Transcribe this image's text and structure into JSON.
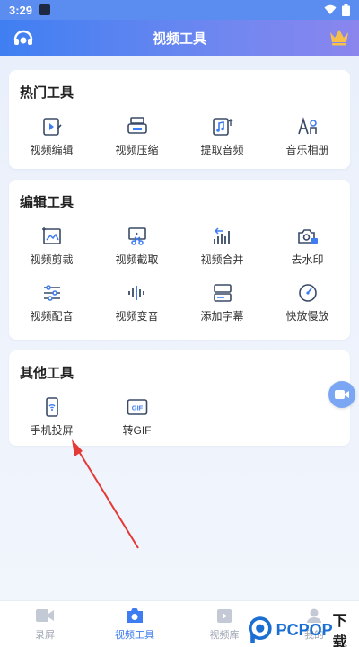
{
  "status": {
    "time": "3:29"
  },
  "header": {
    "title": "视频工具"
  },
  "sections": [
    {
      "title": "热门工具",
      "items": [
        {
          "label": "视频编辑",
          "icon": "video-edit-icon"
        },
        {
          "label": "视频压缩",
          "icon": "video-compress-icon"
        },
        {
          "label": "提取音频",
          "icon": "extract-audio-icon"
        },
        {
          "label": "音乐相册",
          "icon": "music-album-icon"
        }
      ]
    },
    {
      "title": "编辑工具",
      "items": [
        {
          "label": "视频剪裁",
          "icon": "crop-icon"
        },
        {
          "label": "视频截取",
          "icon": "cut-icon"
        },
        {
          "label": "视频合并",
          "icon": "merge-icon"
        },
        {
          "label": "去水印",
          "icon": "watermark-remove-icon"
        },
        {
          "label": "视频配音",
          "icon": "dubbing-icon"
        },
        {
          "label": "视频变音",
          "icon": "voice-change-icon"
        },
        {
          "label": "添加字幕",
          "icon": "subtitle-icon"
        },
        {
          "label": "快放慢放",
          "icon": "speed-icon"
        }
      ]
    },
    {
      "title": "其他工具",
      "items": [
        {
          "label": "手机投屏",
          "icon": "screen-cast-icon"
        },
        {
          "label": "转GIF",
          "icon": "gif-icon"
        }
      ]
    }
  ],
  "tabs": [
    {
      "label": "录屏",
      "icon": "record-icon",
      "active": false
    },
    {
      "label": "视频工具",
      "icon": "tools-icon",
      "active": true
    },
    {
      "label": "视频库",
      "icon": "library-icon",
      "active": false
    },
    {
      "label": "我的",
      "icon": "profile-icon",
      "active": false
    }
  ],
  "watermark": {
    "brand": "PCPOP",
    "suffix": "下载"
  },
  "colors": {
    "accent": "#3e7cf1",
    "header_start": "#3f7ff2",
    "header_end": "#8a86ee",
    "arrow": "#e53935"
  }
}
